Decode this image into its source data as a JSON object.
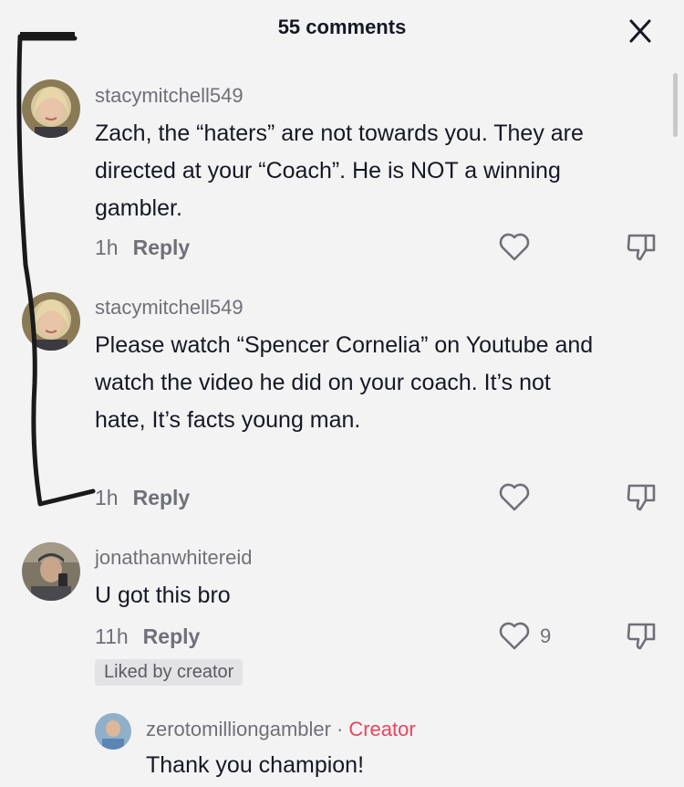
{
  "header": {
    "title": "55 comments",
    "close_icon": "close-icon"
  },
  "comments": [
    {
      "username": "stacymitchell549",
      "text": "Zach, the “haters” are not towards you. They are directed at your “Coach”. He is NOT a winning gambler.",
      "time": "1h",
      "reply_label": "Reply"
    },
    {
      "username": "stacymitchell549",
      "text": "Please watch “Spencer Cornelia” on Youtube and watch the video he did on your coach. It’s not hate, It’s facts young man.",
      "time": "1h",
      "reply_label": "Reply"
    },
    {
      "username": "jonathanwhitereid",
      "text": "U got this bro",
      "time": "11h",
      "reply_label": "Reply",
      "like_count": "9",
      "badge": "Liked by creator"
    }
  ],
  "reply": {
    "username": "zerotomilliongambler",
    "separator": "·",
    "creator_label": "Creator",
    "text": "Thank you champion!"
  },
  "colors": {
    "accent_creator": "#e8455c",
    "muted": "#6f7078",
    "background": "#f3f3f4"
  }
}
